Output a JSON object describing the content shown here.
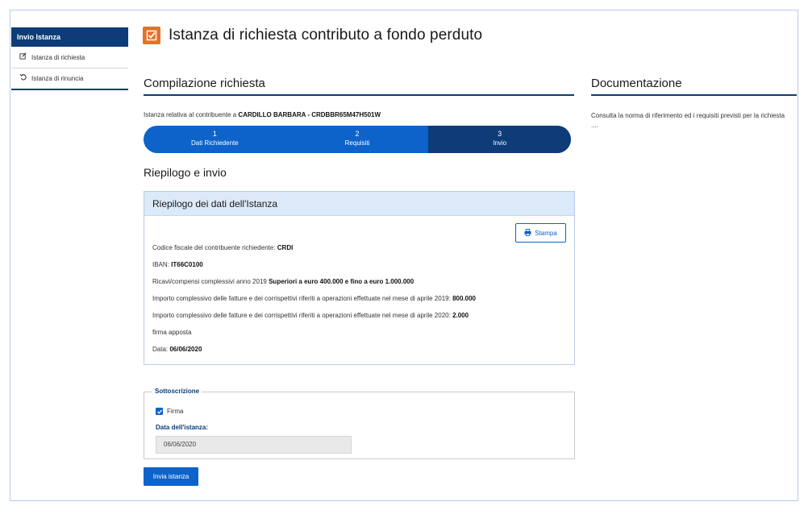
{
  "sidebar": {
    "header": "Invio Istanza",
    "items": [
      {
        "label": "Istanza di richiesta",
        "icon": "edit-icon"
      },
      {
        "label": "Istanza di rinuncia",
        "icon": "undo-icon"
      }
    ]
  },
  "page": {
    "title": "Istanza di richiesta contributo a fondo perduto",
    "accent": "#e8702a",
    "brand": "#0d3c78"
  },
  "main": {
    "section_title": "Compilazione richiesta",
    "subject_prefix": "Istanza relativa al contribuente a",
    "subject_name": "CARDILLO BARBARA - CRDBBR65M47H501W",
    "steps": [
      {
        "num": "1",
        "label": "Dati Richiedente"
      },
      {
        "num": "2",
        "label": "Requisiti"
      },
      {
        "num": "3",
        "label": "Invio"
      }
    ],
    "recap_title": "Riepilogo e invio",
    "card": {
      "title": "Riepilogo dei dati dell'Istanza",
      "print_label": "Stampa",
      "lines": [
        {
          "label": "Codice fiscale del contribuente richiedente:",
          "value": "CRDI"
        },
        {
          "label": "IBAN:",
          "value": "IT66C0100"
        },
        {
          "label": "Ricavi/compensi complessivi anno 2019",
          "value": "Superiori a euro 400.000 e fino a euro 1.000.000"
        },
        {
          "label": "Importo complessivo delle fatture e dei corrispettivi riferiti a operazioni effettuate nel mese di aprile 2019:",
          "value": "800.000"
        },
        {
          "label": "Importo complessivo delle fatture e dei corrispettivi riferiti a operazioni effettuate nel mese di aprile 2020:",
          "value": "2.000"
        },
        {
          "label": "firma apposta",
          "value": ""
        },
        {
          "label": "Data:",
          "value": "06/06/2020"
        }
      ]
    },
    "subscription": {
      "legend": "Sottoscrizione",
      "checkbox_label": "Firma",
      "checked": true,
      "date_label": "Data dell'istanza:",
      "date_value": "06/06/2020"
    },
    "send_label": "Invia istanza"
  },
  "docs": {
    "title": "Documentazione",
    "text": "Consulta la norma di riferimento ed i requisiti previsti per la richiesta ...."
  }
}
